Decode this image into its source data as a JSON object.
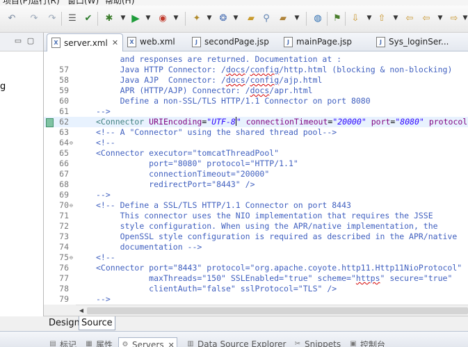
{
  "menu": {
    "items": [
      "项目(P)",
      "运行(R)",
      "窗口(W)",
      "帮助(H)"
    ]
  },
  "toolbar": {
    "icons": [
      "undo-icon",
      "redo-icon",
      "open-type-icon",
      "spell-check-icon",
      "debug-icon",
      "run-icon",
      "external-tools-icon",
      "new-server-icon",
      "new-wizard-icon",
      "open-folder-icon",
      "search-icon",
      "globe-icon",
      "pin-icon",
      "next-annotation-icon",
      "prev-annotation-icon",
      "back-icon",
      "forward-icon"
    ]
  },
  "left_pane": {
    "partial_text": "g"
  },
  "editor_tabs": [
    {
      "label": "server.xml",
      "active": true,
      "closable": true
    },
    {
      "label": "web.xml",
      "active": false,
      "closable": false
    },
    {
      "label": "secondPage.jsp",
      "active": false,
      "closable": false
    },
    {
      "label": "mainPage.jsp",
      "active": false,
      "closable": false
    },
    {
      "label": "Sys_loginSer...",
      "active": false,
      "closable": false
    }
  ],
  "editor": {
    "lines": [
      {
        "num": "",
        "fold": "",
        "marker": false,
        "current": false,
        "parts": [
          {
            "t": "and responses are returned. Documentation at :",
            "c": "com"
          }
        ],
        "indent": "     "
      },
      {
        "num": "57",
        "fold": "",
        "marker": false,
        "current": false,
        "parts": [
          {
            "t": "Java HTTP Connector: /",
            "c": "com"
          },
          {
            "t": "docs",
            "c": "com sq"
          },
          {
            "t": "/",
            "c": "com"
          },
          {
            "t": "config",
            "c": "com sq"
          },
          {
            "t": "/http.html (blocking & non-blocking)",
            "c": "com"
          }
        ],
        "indent": "     "
      },
      {
        "num": "58",
        "fold": "",
        "marker": false,
        "current": false,
        "parts": [
          {
            "t": "Java AJP  Connector: /",
            "c": "com"
          },
          {
            "t": "docs",
            "c": "com sq"
          },
          {
            "t": "/",
            "c": "com"
          },
          {
            "t": "config",
            "c": "com sq"
          },
          {
            "t": "/ajp.html",
            "c": "com"
          }
        ],
        "indent": "     "
      },
      {
        "num": "59",
        "fold": "",
        "marker": false,
        "current": false,
        "parts": [
          {
            "t": "APR (HTTP/AJP) Connector: /",
            "c": "com"
          },
          {
            "t": "docs",
            "c": "com sq"
          },
          {
            "t": "/apr.html",
            "c": "com"
          }
        ],
        "indent": "     "
      },
      {
        "num": "60",
        "fold": "",
        "marker": false,
        "current": false,
        "parts": [
          {
            "t": "Define a non-SSL/TLS HTTP/1.1 Connector on port 8080",
            "c": "com"
          }
        ],
        "indent": "     "
      },
      {
        "num": "61",
        "fold": "",
        "marker": false,
        "current": false,
        "parts": [
          {
            "t": "-->",
            "c": "com"
          }
        ],
        "indent": ""
      },
      {
        "num": "62",
        "fold": "",
        "marker": true,
        "current": true,
        "parts": [
          {
            "t": "<Connector ",
            "c": "tag"
          },
          {
            "t": "URIEncoding",
            "c": "att"
          },
          {
            "t": "=",
            "c": "txt"
          },
          {
            "t": "\"UTF-8",
            "c": "val"
          },
          {
            "t": "|",
            "c": "caret"
          },
          {
            "t": "\"",
            "c": "val"
          },
          {
            "t": " connectionTimeout",
            "c": "att"
          },
          {
            "t": "=",
            "c": "txt"
          },
          {
            "t": "\"20000\"",
            "c": "val"
          },
          {
            "t": " port",
            "c": "att"
          },
          {
            "t": "=",
            "c": "txt"
          },
          {
            "t": "\"8080\"",
            "c": "val"
          },
          {
            "t": " protocol",
            "c": "att"
          }
        ],
        "indent": ""
      },
      {
        "num": "63",
        "fold": "",
        "marker": false,
        "current": false,
        "parts": [
          {
            "t": "<!-- A \"Connector\" using the shared thread pool-->",
            "c": "com"
          }
        ],
        "indent": ""
      },
      {
        "num": "64",
        "fold": "⊖",
        "marker": false,
        "current": false,
        "parts": [
          {
            "t": "<!--",
            "c": "com"
          }
        ],
        "indent": ""
      },
      {
        "num": "65",
        "fold": "",
        "marker": false,
        "current": false,
        "parts": [
          {
            "t": "<Connector executor=\"tomcatThreadPool\"",
            "c": "com"
          }
        ],
        "indent": ""
      },
      {
        "num": "66",
        "fold": "",
        "marker": false,
        "current": false,
        "parts": [
          {
            "t": "port=\"8080\" protocol=\"HTTP/1.1\"",
            "c": "com"
          }
        ],
        "indent": "           "
      },
      {
        "num": "67",
        "fold": "",
        "marker": false,
        "current": false,
        "parts": [
          {
            "t": "connectionTimeout=\"20000\"",
            "c": "com"
          }
        ],
        "indent": "           "
      },
      {
        "num": "68",
        "fold": "",
        "marker": false,
        "current": false,
        "parts": [
          {
            "t": "redirectPort=\"8443\" />",
            "c": "com"
          }
        ],
        "indent": "           "
      },
      {
        "num": "69",
        "fold": "",
        "marker": false,
        "current": false,
        "parts": [
          {
            "t": "-->",
            "c": "com"
          }
        ],
        "indent": ""
      },
      {
        "num": "70",
        "fold": "⊖",
        "marker": false,
        "current": false,
        "parts": [
          {
            "t": "<!-- Define a SSL/TLS HTTP/1.1 Connector on port 8443",
            "c": "com"
          }
        ],
        "indent": ""
      },
      {
        "num": "71",
        "fold": "",
        "marker": false,
        "current": false,
        "parts": [
          {
            "t": "This connector uses the NIO implementation that requires the JSSE",
            "c": "com"
          }
        ],
        "indent": "     "
      },
      {
        "num": "72",
        "fold": "",
        "marker": false,
        "current": false,
        "parts": [
          {
            "t": "style configuration. When using the APR/native implementation, the",
            "c": "com"
          }
        ],
        "indent": "     "
      },
      {
        "num": "73",
        "fold": "",
        "marker": false,
        "current": false,
        "parts": [
          {
            "t": "OpenSSL style configuration is required as described in the APR/native",
            "c": "com"
          }
        ],
        "indent": "     "
      },
      {
        "num": "74",
        "fold": "",
        "marker": false,
        "current": false,
        "parts": [
          {
            "t": "documentation -->",
            "c": "com"
          }
        ],
        "indent": "     "
      },
      {
        "num": "75",
        "fold": "⊖",
        "marker": false,
        "current": false,
        "parts": [
          {
            "t": "<!--",
            "c": "com"
          }
        ],
        "indent": ""
      },
      {
        "num": "76",
        "fold": "",
        "marker": false,
        "current": false,
        "parts": [
          {
            "t": "<Connector port=\"8443\" protocol=\"org.apache.coyote.http11.Http11NioProtocol\"",
            "c": "com"
          }
        ],
        "indent": ""
      },
      {
        "num": "77",
        "fold": "",
        "marker": false,
        "current": false,
        "parts": [
          {
            "t": "maxThreads=\"150\" SSLEnabled=\"true\" scheme=\"",
            "c": "com"
          },
          {
            "t": "https",
            "c": "com sq"
          },
          {
            "t": "\" secure=\"true\"",
            "c": "com"
          }
        ],
        "indent": "           "
      },
      {
        "num": "78",
        "fold": "",
        "marker": false,
        "current": false,
        "parts": [
          {
            "t": "clientAuth=\"false\" sslProtocol=\"TLS\" />",
            "c": "com"
          }
        ],
        "indent": "           "
      },
      {
        "num": "79",
        "fold": "",
        "marker": false,
        "current": false,
        "parts": [
          {
            "t": "-->",
            "c": "com"
          }
        ],
        "indent": ""
      },
      {
        "num": "80",
        "fold": "",
        "marker": false,
        "current": false,
        "parts": [
          {
            "t": "",
            "c": "com"
          }
        ],
        "indent": ""
      }
    ]
  },
  "page_tabs": [
    {
      "label": "Design",
      "active": false
    },
    {
      "label": "Source",
      "active": true
    }
  ],
  "bottom_tabs": [
    {
      "label": "标记",
      "icon": "markers-icon",
      "active": false,
      "closable": false
    },
    {
      "label": "属性",
      "icon": "properties-icon",
      "active": false,
      "closable": false
    },
    {
      "label": "Servers",
      "icon": "servers-icon",
      "active": true,
      "closable": true
    },
    {
      "label": "Data Source Explorer",
      "icon": "data-source-icon",
      "active": false,
      "closable": false
    },
    {
      "label": "Snippets",
      "icon": "snippets-icon",
      "active": false,
      "closable": false
    },
    {
      "label": "控制台",
      "icon": "console-icon",
      "active": false,
      "closable": false
    }
  ]
}
